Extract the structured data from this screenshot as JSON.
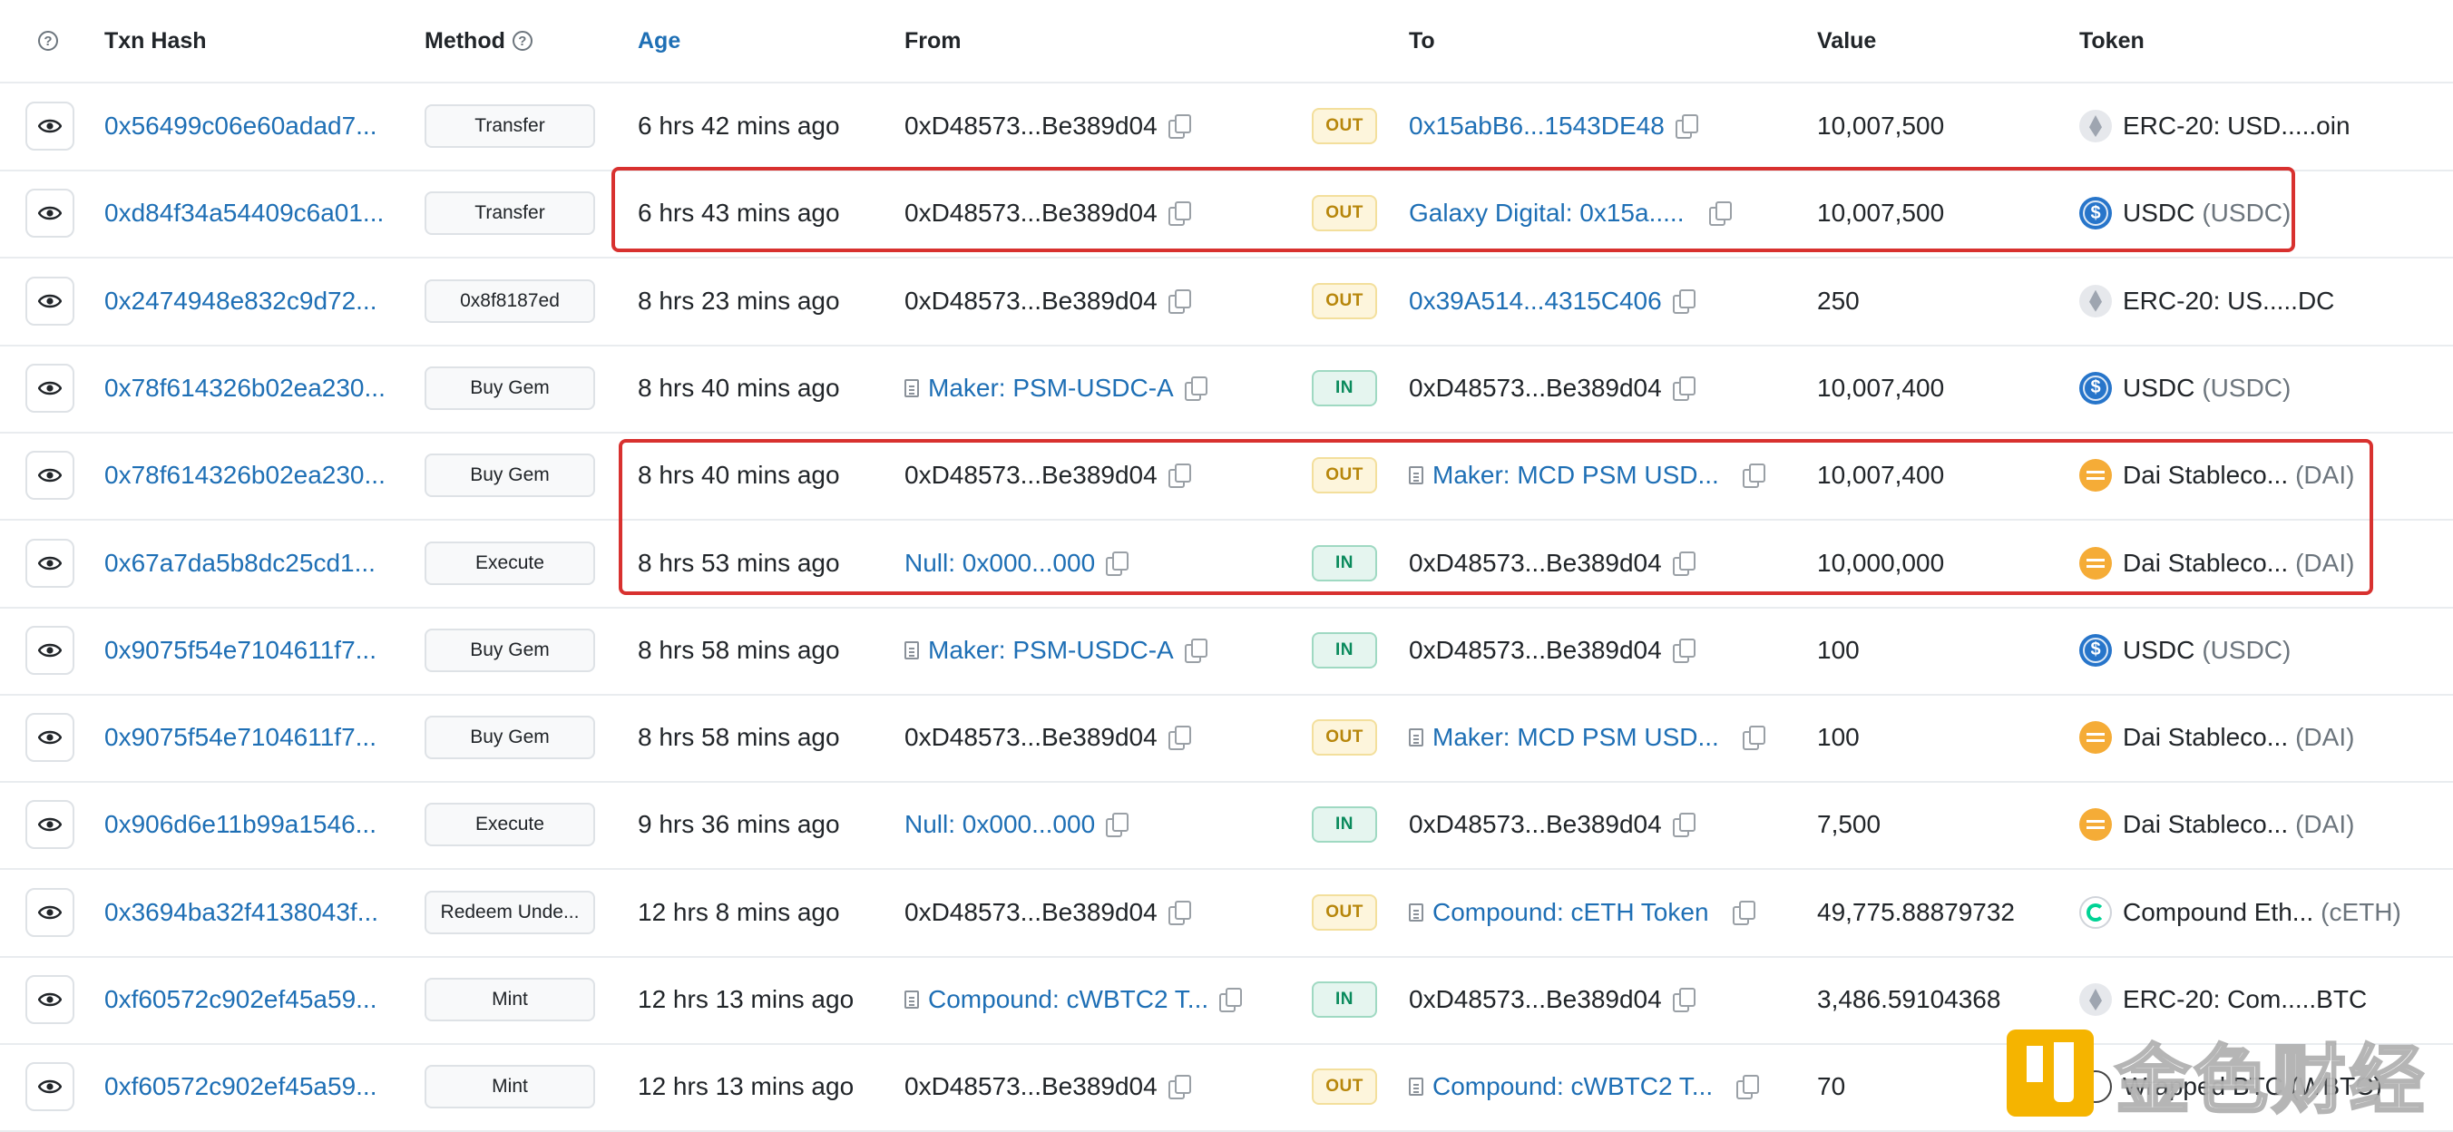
{
  "header": {
    "txn_hash": "Txn Hash",
    "method": "Method",
    "age": "Age",
    "from": "From",
    "to": "To",
    "value": "Value",
    "token": "Token"
  },
  "rows": [
    {
      "hash": "0x56499c06e60adad7...",
      "method": "Transfer",
      "age": "6 hrs 42 mins ago",
      "from": "0xD48573...Be389d04",
      "from_contract": false,
      "direction": "OUT",
      "to": "0x15abB6...1543DE48",
      "to_contract": false,
      "to_link": true,
      "value": "10,007,500",
      "token_icon": "eth-icon",
      "token_name": "ERC-20: USD.....oin",
      "token_symbol": ""
    },
    {
      "hash": "0xd84f34a54409c6a01...",
      "method": "Transfer",
      "age": "6 hrs 43 mins ago",
      "from": "0xD48573...Be389d04",
      "from_contract": false,
      "direction": "OUT",
      "to": "Galaxy Digital: 0x15a.....",
      "to_contract": false,
      "to_link": true,
      "value": "10,007,500",
      "token_icon": "usdc-icon",
      "token_name": "USDC",
      "token_symbol": "(USDC)"
    },
    {
      "hash": "0x2474948e832c9d72...",
      "method": "0x8f8187ed",
      "age": "8 hrs 23 mins ago",
      "from": "0xD48573...Be389d04",
      "from_contract": false,
      "direction": "OUT",
      "to": "0x39A514...4315C406",
      "to_contract": false,
      "to_link": true,
      "value": "250",
      "token_icon": "eth-icon",
      "token_name": "ERC-20: US.....DC",
      "token_symbol": ""
    },
    {
      "hash": "0x78f614326b02ea230...",
      "method": "Buy Gem",
      "age": "8 hrs 40 mins ago",
      "from": "Maker: PSM-USDC-A",
      "from_contract": true,
      "direction": "IN",
      "to": "0xD48573...Be389d04",
      "to_contract": false,
      "to_link": false,
      "value": "10,007,400",
      "token_icon": "usdc-icon",
      "token_name": "USDC",
      "token_symbol": "(USDC)"
    },
    {
      "hash": "0x78f614326b02ea230...",
      "method": "Buy Gem",
      "age": "8 hrs 40 mins ago",
      "from": "0xD48573...Be389d04",
      "from_contract": false,
      "direction": "OUT",
      "to": "Maker: MCD PSM USD...",
      "to_contract": true,
      "to_link": true,
      "value": "10,007,400",
      "token_icon": "dai-icon",
      "token_name": "Dai Stableco...",
      "token_symbol": "(DAI)"
    },
    {
      "hash": "0x67a7da5b8dc25cd1...",
      "method": "Execute",
      "age": "8 hrs 53 mins ago",
      "from": "Null: 0x000...000",
      "from_contract": false,
      "from_link": true,
      "direction": "IN",
      "to": "0xD48573...Be389d04",
      "to_contract": false,
      "to_link": false,
      "value": "10,000,000",
      "token_icon": "dai-icon",
      "token_name": "Dai Stableco...",
      "token_symbol": "(DAI)"
    },
    {
      "hash": "0x9075f54e7104611f7...",
      "method": "Buy Gem",
      "age": "8 hrs 58 mins ago",
      "from": "Maker: PSM-USDC-A",
      "from_contract": true,
      "direction": "IN",
      "to": "0xD48573...Be389d04",
      "to_contract": false,
      "to_link": false,
      "value": "100",
      "token_icon": "usdc-icon",
      "token_name": "USDC",
      "token_symbol": "(USDC)"
    },
    {
      "hash": "0x9075f54e7104611f7...",
      "method": "Buy Gem",
      "age": "8 hrs 58 mins ago",
      "from": "0xD48573...Be389d04",
      "from_contract": false,
      "direction": "OUT",
      "to": "Maker: MCD PSM USD...",
      "to_contract": true,
      "to_link": true,
      "value": "100",
      "token_icon": "dai-icon",
      "token_name": "Dai Stableco...",
      "token_symbol": "(DAI)"
    },
    {
      "hash": "0x906d6e11b99a1546...",
      "method": "Execute",
      "age": "9 hrs 36 mins ago",
      "from": "Null: 0x000...000",
      "from_contract": false,
      "from_link": true,
      "direction": "IN",
      "to": "0xD48573...Be389d04",
      "to_contract": false,
      "to_link": false,
      "value": "7,500",
      "token_icon": "dai-icon",
      "token_name": "Dai Stableco...",
      "token_symbol": "(DAI)"
    },
    {
      "hash": "0x3694ba32f4138043f...",
      "method": "Redeem Unde...",
      "age": "12 hrs 8 mins ago",
      "from": "0xD48573...Be389d04",
      "from_contract": false,
      "direction": "OUT",
      "to": "Compound: cETH Token",
      "to_contract": true,
      "to_link": true,
      "value": "49,775.88879732",
      "token_icon": "ceth-icon",
      "token_name": "Compound Eth...",
      "token_symbol": "(cETH)"
    },
    {
      "hash": "0xf60572c902ef45a59...",
      "method": "Mint",
      "age": "12 hrs 13 mins ago",
      "from": "Compound: cWBTC2 T...",
      "from_contract": true,
      "direction": "IN",
      "to": "0xD48573...Be389d04",
      "to_contract": false,
      "to_link": false,
      "value": "3,486.59104368",
      "token_icon": "eth-icon",
      "token_name": "ERC-20: Com.....BTC",
      "token_symbol": ""
    },
    {
      "hash": "0xf60572c902ef45a59...",
      "method": "Mint",
      "age": "12 hrs 13 mins ago",
      "from": "0xD48573...Be389d04",
      "from_contract": false,
      "direction": "OUT",
      "to": "Compound: cWBTC2 T...",
      "to_contract": true,
      "to_link": true,
      "value": "70",
      "token_icon": "wbtc-icon",
      "token_name": "Wrapped BTC (WBTC)",
      "token_symbol": ""
    }
  ],
  "watermark": {
    "text": "金色财经"
  },
  "colors": {
    "link": "#1e6fb5",
    "highlight": "#d8312f",
    "out_badge": "#fdf5dc",
    "in_badge": "#e5f5ef"
  }
}
